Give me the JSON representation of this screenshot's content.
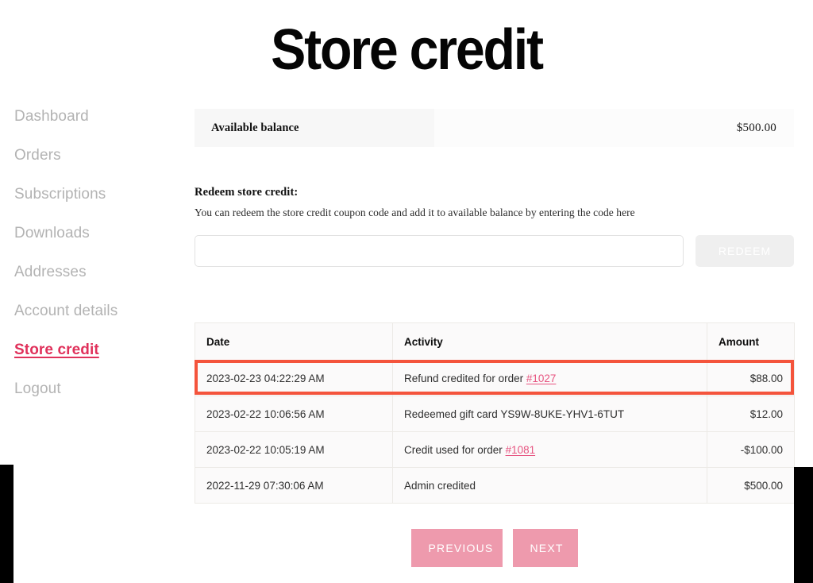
{
  "page": {
    "title": "Store credit"
  },
  "sidebar": {
    "items": [
      {
        "label": "Dashboard",
        "active": false
      },
      {
        "label": "Orders",
        "active": false
      },
      {
        "label": "Subscriptions",
        "active": false
      },
      {
        "label": "Downloads",
        "active": false
      },
      {
        "label": "Addresses",
        "active": false
      },
      {
        "label": "Account details",
        "active": false
      },
      {
        "label": "Store credit",
        "active": true
      },
      {
        "label": "Logout",
        "active": false
      }
    ]
  },
  "balance": {
    "label": "Available balance",
    "value": "$500.00"
  },
  "redeem": {
    "heading": "Redeem store credit:",
    "description": "You can redeem the store credit coupon code and add it to available balance by entering the code here",
    "input_value": "",
    "input_placeholder": "",
    "button_label": "REDEEM"
  },
  "table": {
    "columns": [
      "Date",
      "Activity",
      "Amount"
    ],
    "rows": [
      {
        "date": "2023-02-23 04:22:29 AM",
        "activity_prefix": "Refund credited for order ",
        "activity_link": "#1027",
        "activity_suffix": "",
        "amount": "$88.00",
        "highlighted": true
      },
      {
        "date": "2023-02-22 10:06:56 AM",
        "activity_prefix": "Redeemed gift card YS9W-8UKE-YHV1-6TUT",
        "activity_link": "",
        "activity_suffix": "",
        "amount": "$12.00",
        "highlighted": false
      },
      {
        "date": "2023-02-22 10:05:19 AM",
        "activity_prefix": "Credit used for order ",
        "activity_link": "#1081",
        "activity_suffix": "",
        "amount": "-$100.00",
        "highlighted": false
      },
      {
        "date": "2022-11-29 07:30:06 AM",
        "activity_prefix": "Admin credited",
        "activity_link": "",
        "activity_suffix": "",
        "amount": "$500.00",
        "highlighted": false
      }
    ]
  },
  "pagination": {
    "previous_label": "PREVIOUS",
    "next_label": "NEXT"
  },
  "colors": {
    "accent_link": "#e0315b",
    "order_link": "#e75480",
    "highlight_border": "#f4543c",
    "button_pink": "#ee9aad",
    "redeem_button_bg": "#efefef"
  }
}
